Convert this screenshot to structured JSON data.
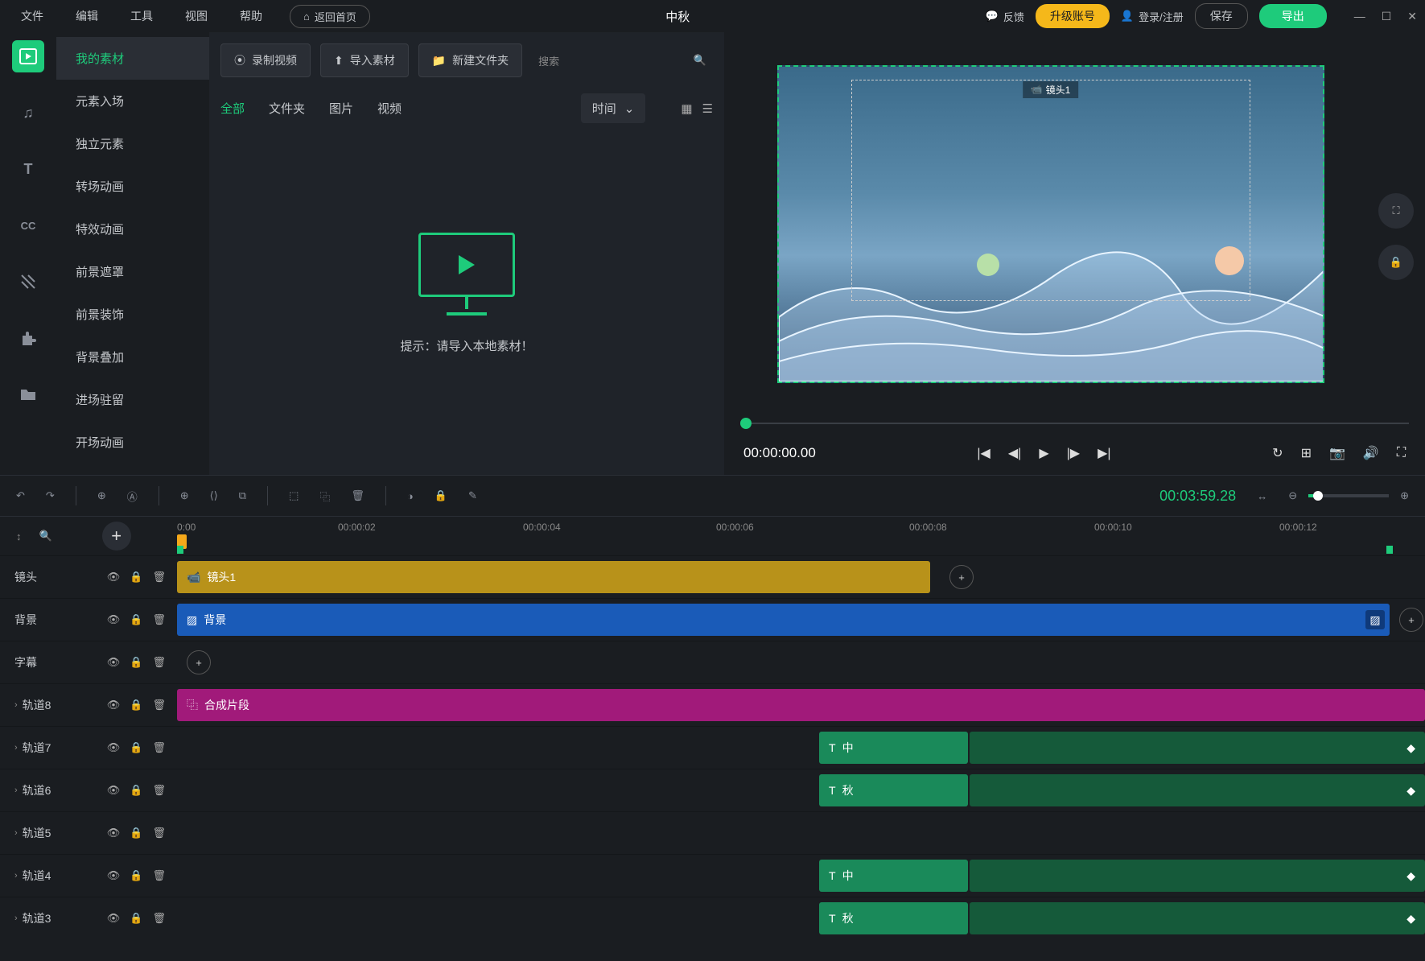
{
  "menu": {
    "file": "文件",
    "edit": "编辑",
    "tools": "工具",
    "view": "视图",
    "help": "帮助",
    "home": "返回首页"
  },
  "project_title": "中秋",
  "top": {
    "feedback": "反馈",
    "upgrade": "升级账号",
    "login": "登录/注册",
    "save": "保存",
    "export": "导出"
  },
  "categories": [
    "我的素材",
    "元素入场",
    "独立元素",
    "转场动画",
    "特效动画",
    "前景遮罩",
    "前景装饰",
    "背景叠加",
    "进场驻留",
    "开场动画"
  ],
  "media": {
    "record": "录制视频",
    "import": "导入素材",
    "newfolder": "新建文件夹",
    "search": "搜索",
    "tabs": {
      "all": "全部",
      "folder": "文件夹",
      "image": "图片",
      "video": "视频"
    },
    "sort": "时间",
    "hint": "提示：请导入本地素材！"
  },
  "preview": {
    "tag": "镜头1",
    "time": "00:00:00.00"
  },
  "toolbar": {
    "duration": "00:03:59.28"
  },
  "ruler": {
    "t0": "0:00",
    "t2": "00:00:02",
    "t4": "00:00:04",
    "t6": "00:00:06",
    "t8": "00:00:08",
    "t10": "00:00:10",
    "t12": "00:00:12"
  },
  "tracks": {
    "camera_label": "镜头",
    "camera_clip": "镜头1",
    "bg_label": "背景",
    "bg_clip": "背景",
    "subtitle_label": "字幕",
    "t8": "轨道8",
    "t8_clip": "合成片段",
    "t7": "轨道7",
    "t6": "轨道6",
    "t5": "轨道5",
    "t4": "轨道4",
    "t3": "轨道3",
    "text_zhong": "中",
    "text_qiu": "秋"
  }
}
